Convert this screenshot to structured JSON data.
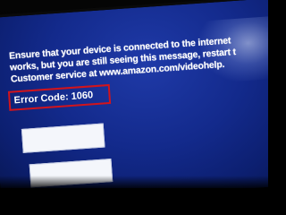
{
  "message": {
    "lines": [
      "Ensure that your device is connected to the internet",
      "works, but you are still seeing this message, restart t",
      "Customer service at www.amazon.com/videohelp."
    ]
  },
  "error": {
    "label": "Error Code: 1060"
  },
  "colors": {
    "screen_blue": "#132a8c",
    "highlight_red": "#d1141c",
    "text": "#ffffff"
  }
}
